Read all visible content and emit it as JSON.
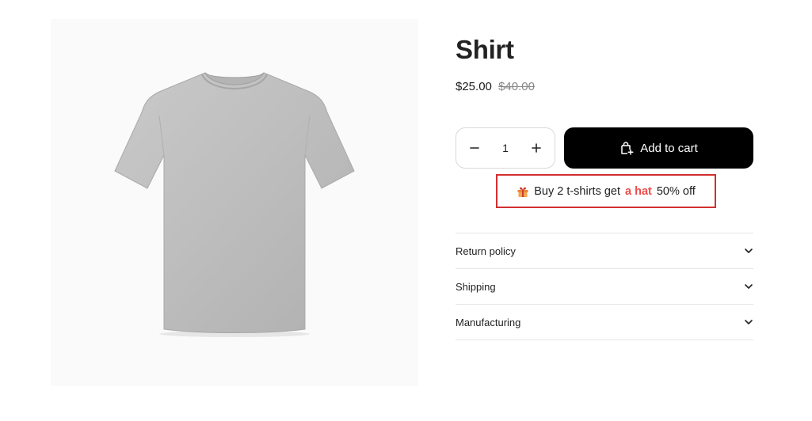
{
  "product": {
    "title": "Shirt",
    "price": "$25.00",
    "compare_price": "$40.00",
    "image_icon": "gray-tshirt-image"
  },
  "quantity": {
    "value": "1",
    "decrease_icon": "minus-icon",
    "increase_icon": "plus-icon"
  },
  "cart": {
    "button_label": "Add to cart",
    "icon": "shopping-bag-plus-icon"
  },
  "promo": {
    "icon": "gift-icon",
    "text_before": "Buy 2 t-shirts get",
    "highlight": "a hat",
    "text_after": "50% off",
    "highlight_color": "#ef4a4a",
    "border_color": "#d32f2f"
  },
  "accordion": {
    "items": [
      {
        "label": "Return policy"
      },
      {
        "label": "Shipping"
      },
      {
        "label": "Manufacturing"
      }
    ],
    "icon": "chevron-down-icon"
  }
}
